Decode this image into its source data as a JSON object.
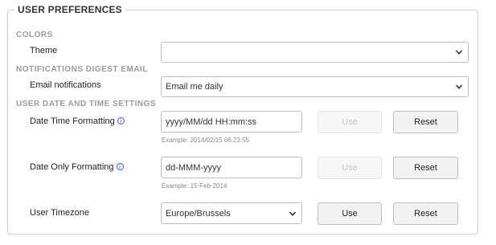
{
  "panel": {
    "title": "USER PREFERENCES"
  },
  "colors": {
    "section": "COLORS",
    "theme_label": "Theme",
    "theme_value": ""
  },
  "notifications": {
    "section": "NOTIFICATIONS DIGEST EMAIL",
    "email_label": "Email notifications",
    "email_value": "Email me daily"
  },
  "datetime": {
    "section": "USER DATE AND TIME SETTINGS",
    "datetime_label": "Date Time Formatting",
    "datetime_value": "yyyy/MM/dd HH:mm:ss",
    "datetime_example": "Example: 2014/02/15 06:23:55",
    "dateonly_label": "Date Only Formatting",
    "dateonly_value": "dd-MMM-yyyy",
    "dateonly_example": "Example: 15-Feb-2014",
    "timezone_label": "User Timezone",
    "timezone_value": "Europe/Brussels",
    "info_glyph": "i",
    "use_label": "Use",
    "reset_label": "Reset"
  },
  "icons": {
    "info": "info-icon",
    "chevron": "chevron-down-icon"
  },
  "colors_ui": {
    "section_text": "#9a9a9a",
    "info_blue": "#3b5bdb",
    "disabled_text": "#c6c6c6"
  }
}
